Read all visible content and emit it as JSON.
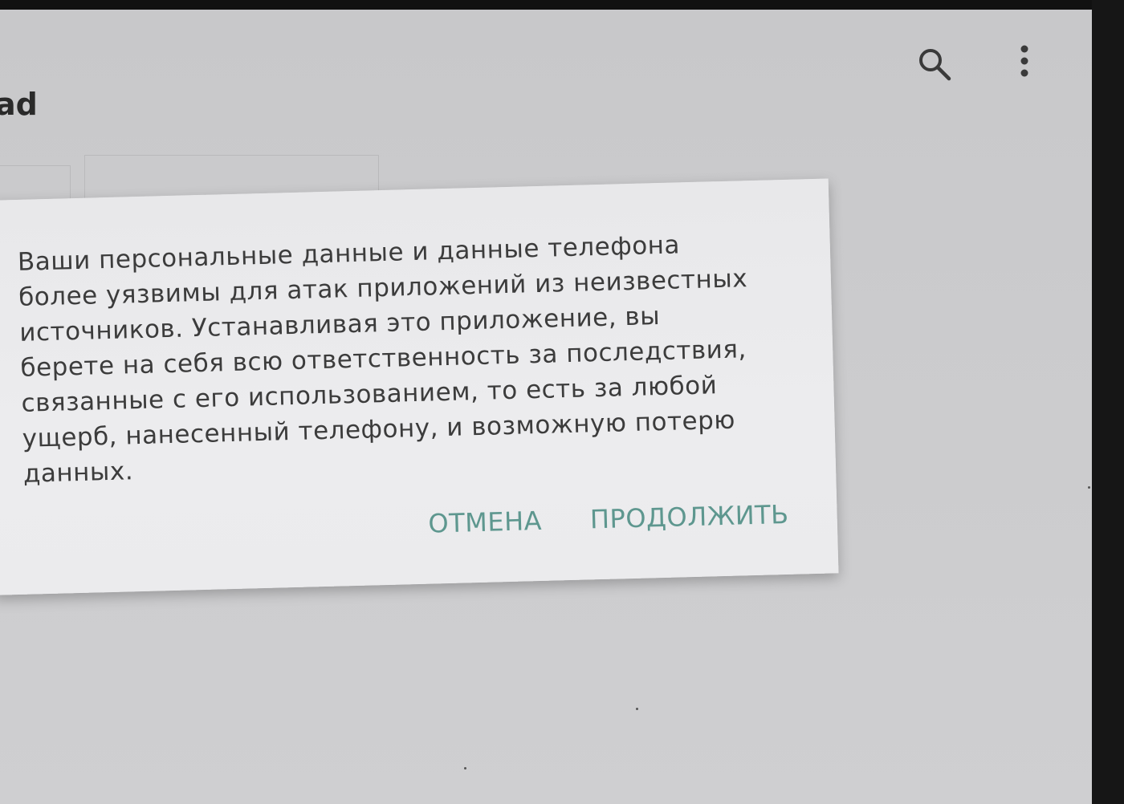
{
  "app": {
    "title": "ad"
  },
  "toolbar": {
    "icons": [
      "search-icon",
      "more-vert-icon"
    ]
  },
  "dialog": {
    "message": "Ваши персональные данные и данные телефона более уязвимы для атак приложений из неизвестных источников. Устанавливая это приложение, вы берете на себя всю ответственность за последствия, связанные с его использованием, то есть за любой ущерб, нанесенный телефону, и возможную потерю данных.",
    "cancel_label": "ОТМЕНА",
    "continue_label": "ПРОДОЛЖИТЬ"
  },
  "colors": {
    "accent": "#5e978f",
    "dialog_background": "#ebebed",
    "screen_background": "#cbcbcd",
    "text": "#3c3c3c"
  }
}
